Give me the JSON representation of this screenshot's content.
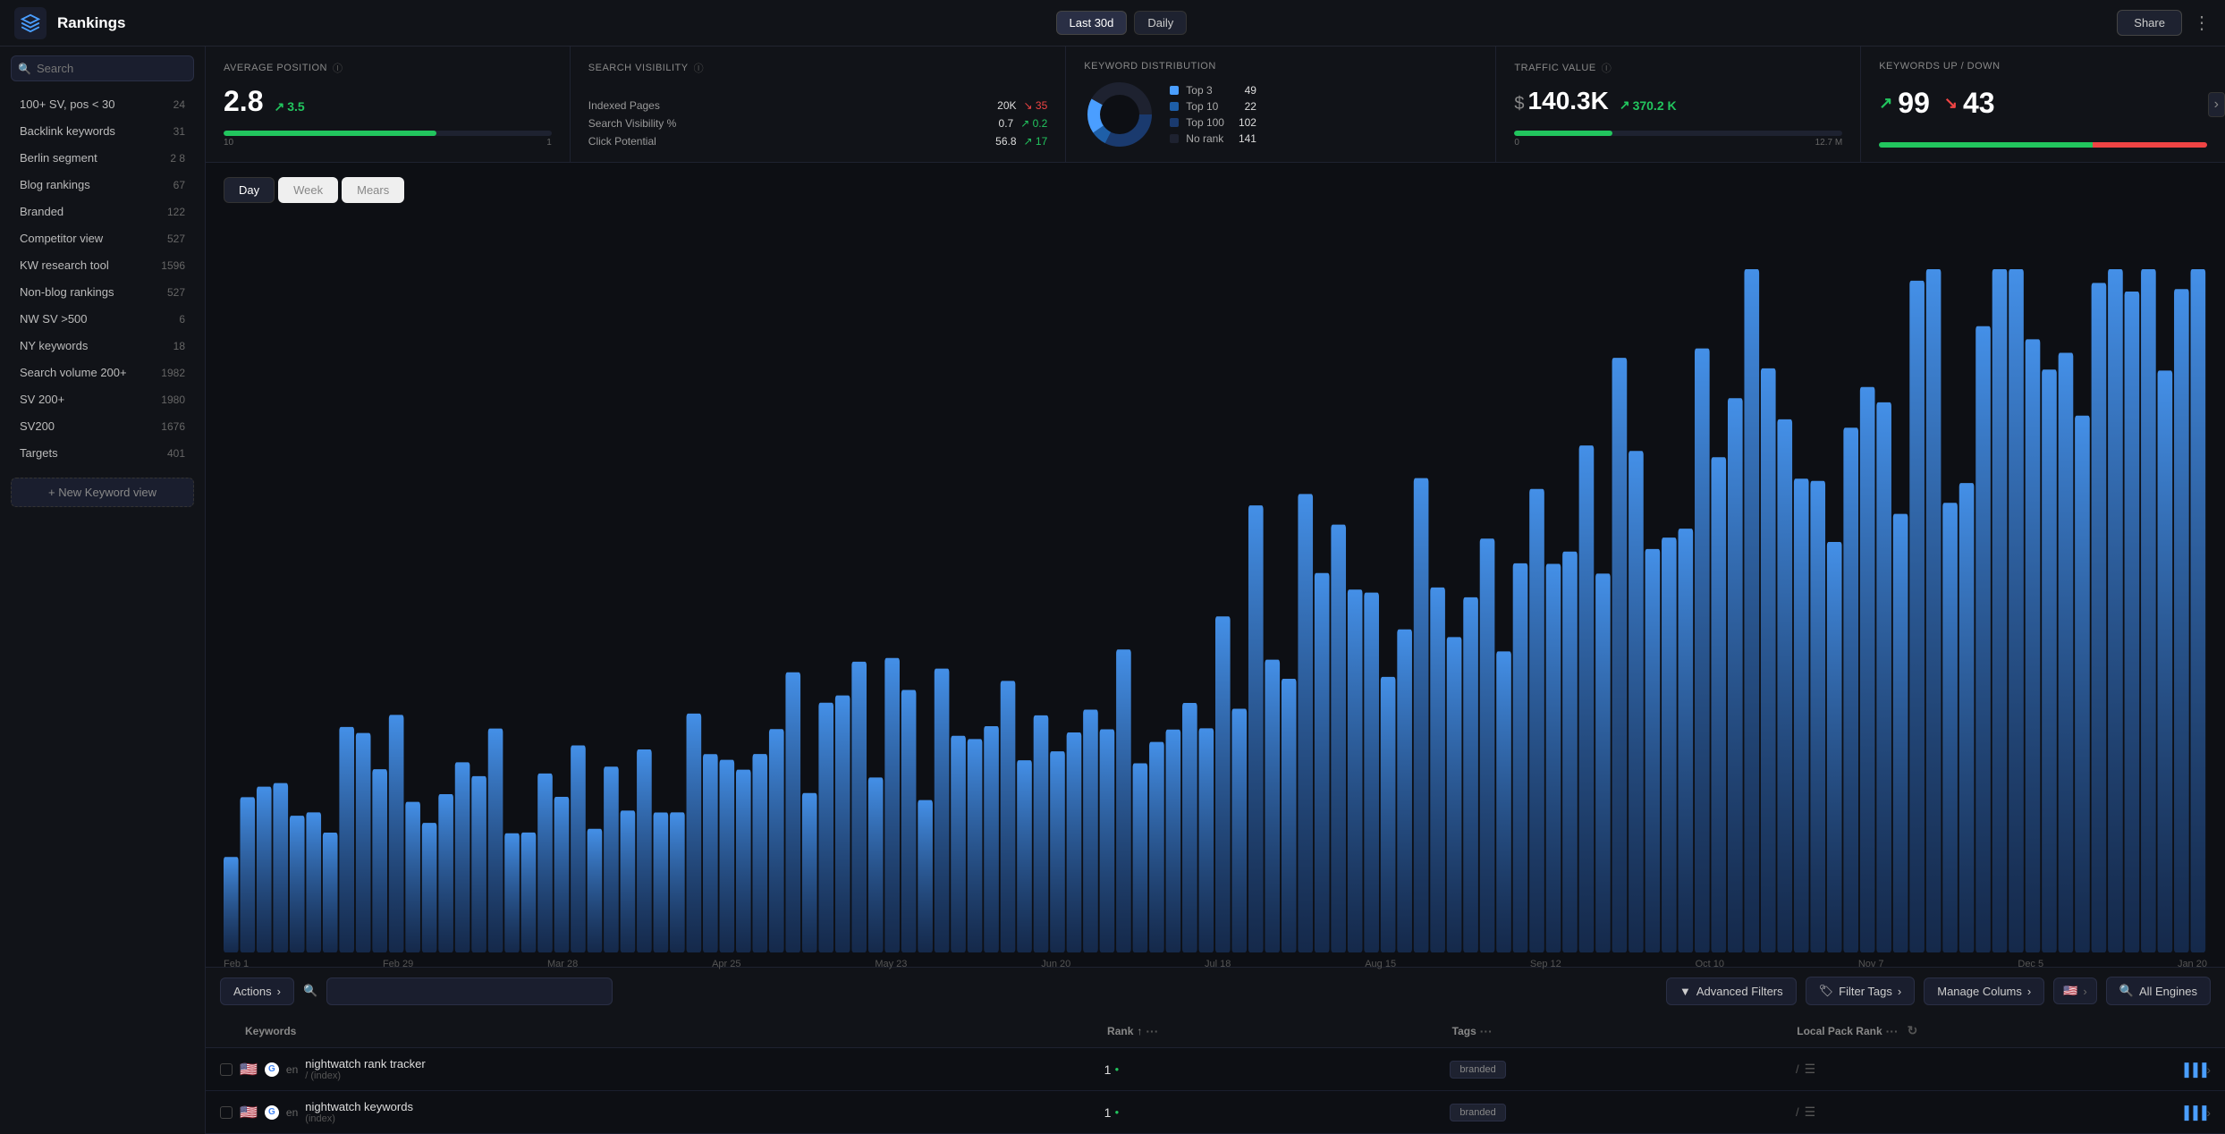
{
  "app": {
    "title": "Rankings",
    "share_label": "Share"
  },
  "topnav": {
    "period_btn": "Last 30d",
    "daily_btn": "Daily"
  },
  "sidebar": {
    "search_placeholder": "Search",
    "items": [
      {
        "label": "100+ SV, pos < 30",
        "count": "24"
      },
      {
        "label": "Backlink keywords",
        "count": "31"
      },
      {
        "label": "Berlin segment",
        "count": "2 8"
      },
      {
        "label": "Blog rankings",
        "count": "67"
      },
      {
        "label": "Branded",
        "count": "122"
      },
      {
        "label": "Competitor view",
        "count": "527"
      },
      {
        "label": "KW research tool",
        "count": "1596"
      },
      {
        "label": "Non-blog rankings",
        "count": "527"
      },
      {
        "label": "NW SV >500",
        "count": "6"
      },
      {
        "label": "NY keywords",
        "count": "18"
      },
      {
        "label": "Search volume 200+",
        "count": "1982"
      },
      {
        "label": "SV 200+",
        "count": "1980"
      },
      {
        "label": "SV200",
        "count": "1676"
      },
      {
        "label": "Targets",
        "count": "401"
      }
    ],
    "new_view_label": "+ New Keyword view"
  },
  "metrics": {
    "avg_position": {
      "label": "AVERAGE POSITION",
      "value": "2.8",
      "change": "3.5",
      "change_dir": "up",
      "bar_fill_pct": 65,
      "scale_low": "10",
      "scale_high": "1"
    },
    "search_visibility": {
      "label": "SEARCH VISIBILITY",
      "rows": [
        {
          "label": "Indexed Pages",
          "value": "20K",
          "change": "35",
          "change_dir": "down"
        },
        {
          "label": "Search Visibility %",
          "value": "0.7",
          "change": "0.2",
          "change_dir": "up"
        },
        {
          "label": "Click Potential",
          "value": "56.8",
          "change": "17",
          "change_dir": "up"
        }
      ]
    },
    "keyword_distribution": {
      "label": "KEYWORD DISTRIBUTION",
      "segments": [
        {
          "label": "Top 3",
          "value": 49,
          "color": "#4a9eff"
        },
        {
          "label": "Top 10",
          "value": 22,
          "color": "#1e5fa8"
        },
        {
          "label": "Top 100",
          "value": 102,
          "color": "#1a3a6e"
        },
        {
          "label": "No rank",
          "value": 141,
          "color": "#1e2230"
        }
      ]
    },
    "traffic_value": {
      "label": "TRAFFIC VALUE",
      "dollar": "$",
      "value": "140.3K",
      "change": "370.2 K",
      "change_dir": "up",
      "bar_fill_pct": 30,
      "scale_low": "0",
      "scale_high": "12.7 M"
    },
    "keywords_updown": {
      "label": "KEYWORDS UP / DOWN",
      "up_val": "99",
      "down_val": "43",
      "bar_up_pct": 65,
      "bar_down_pct": 35
    }
  },
  "chart": {
    "tabs": [
      "Day",
      "Week",
      "Mears"
    ],
    "active_tab": "Day",
    "x_labels": [
      "Feb 1",
      "Feb 29",
      "Mar 28",
      "Apr 25",
      "May 23",
      "Jun 20",
      "Jul 18",
      "Aug 15",
      "Sep 12",
      "Oct 10",
      "Nov 7",
      "Dec 5",
      "Jan 20"
    ]
  },
  "toolbar": {
    "actions_label": "Actions",
    "search_placeholder": "",
    "advanced_filters_label": "Advanced Filters",
    "filter_tags_label": "Filter Tags",
    "manage_cols_label": "Manage Colums",
    "all_engines_label": "All Engines"
  },
  "table": {
    "headers": {
      "keywords": "Keywords",
      "rank": "Rank",
      "tags": "Tags",
      "local_pack": "Local Pack Rank"
    },
    "rows": [
      {
        "flag": "🇺🇸",
        "lang": "en",
        "keyword": "nightwatch rank tracker",
        "url": "/ (index)",
        "rank": "1",
        "tag": "branded"
      },
      {
        "flag": "🇺🇸",
        "lang": "en",
        "keyword": "nightwatch keywords",
        "url": "(index)",
        "rank": "1",
        "tag": "branded"
      }
    ]
  }
}
